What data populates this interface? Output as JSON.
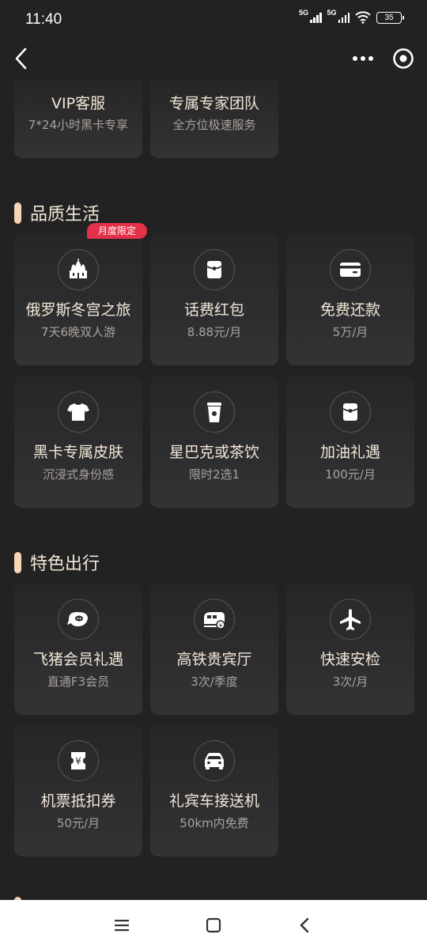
{
  "status_bar": {
    "time": "11:40",
    "network1": "5G",
    "network2": "5G",
    "battery": "35"
  },
  "top_partial": [
    {
      "title": "VIP客服",
      "subtitle": "7*24小时黑卡专享"
    },
    {
      "title": "专属专家团队",
      "subtitle": "全方位极速服务"
    }
  ],
  "sections": {
    "quality": {
      "title": "品质生活",
      "badge": "月度限定",
      "items": [
        {
          "icon": "palace-icon",
          "title": "俄罗斯冬宫之旅",
          "subtitle": "7天6晚双人游"
        },
        {
          "icon": "red-packet-icon",
          "title": "话费红包",
          "subtitle": "8.88元/月"
        },
        {
          "icon": "card-icon",
          "title": "免费还款",
          "subtitle": "5万/月"
        },
        {
          "icon": "tshirt-icon",
          "title": "黑卡专属皮肤",
          "subtitle": "沉浸式身份感"
        },
        {
          "icon": "coffee-cup-icon",
          "title": "星巴克或茶饮",
          "subtitle": "限时2选1"
        },
        {
          "icon": "red-packet-icon",
          "title": "加油礼遇",
          "subtitle": "100元/月"
        }
      ]
    },
    "travel": {
      "title": "特色出行",
      "items": [
        {
          "icon": "fliggy-icon",
          "title": "飞猪会员礼遇",
          "subtitle": "直通F3会员"
        },
        {
          "icon": "train-icon",
          "title": "高铁贵宾厅",
          "subtitle": "3次/季度"
        },
        {
          "icon": "airplane-icon",
          "title": "快速安检",
          "subtitle": "3次/月"
        },
        {
          "icon": "ticket-icon",
          "title": "机票抵扣券",
          "subtitle": "50元/月"
        },
        {
          "icon": "car-icon",
          "title": "礼宾车接送机",
          "subtitle": "50km内免费"
        }
      ]
    }
  },
  "colors": {
    "background": "#222223",
    "card": "#2e2e30",
    "accent": "#f6d4b4",
    "badge": "#e43048"
  }
}
